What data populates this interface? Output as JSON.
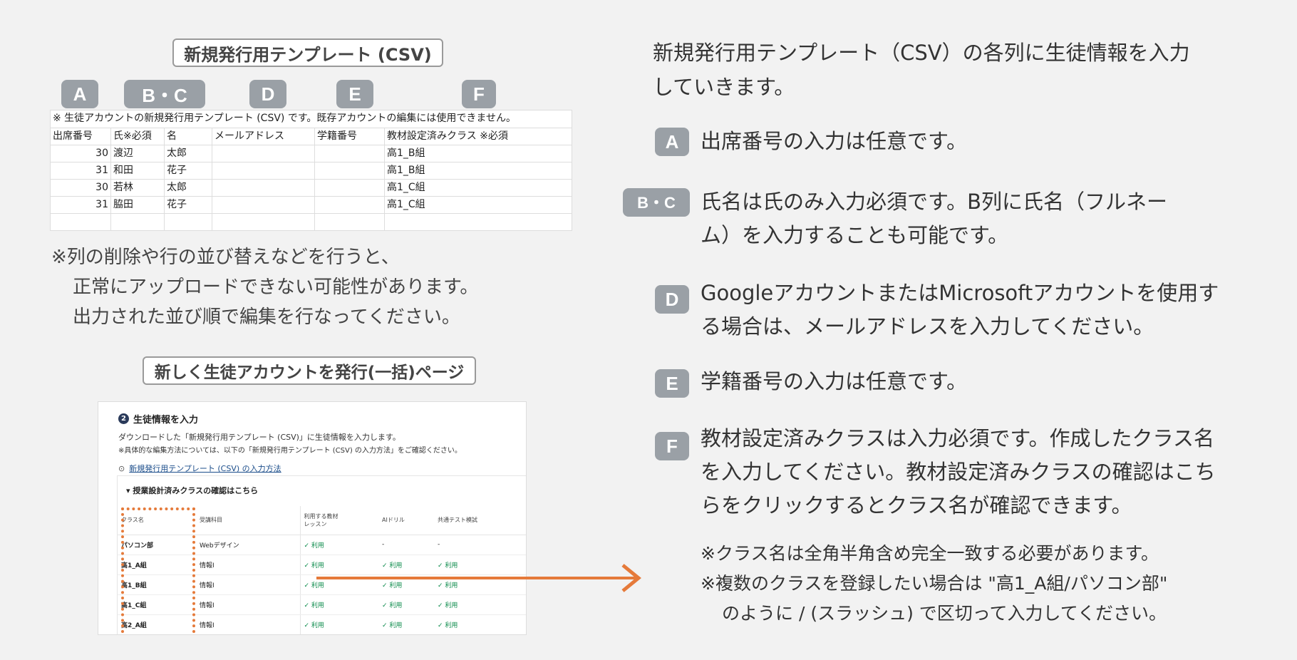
{
  "left": {
    "template_title": "新規発行用テンプレート (CSV)",
    "column_badges": [
      "A",
      "B・C",
      "D",
      "E",
      "F"
    ],
    "csv": {
      "note": "※ 生徒アカウントの新規発行用テンプレート (CSV) です。既存アカウントの編集には使用できません。",
      "headers": [
        "出席番号",
        "氏※必須",
        "名",
        "メールアドレス",
        "学籍番号",
        "教材設定済みクラス ※必須"
      ],
      "rows": [
        [
          "30",
          "渡辺",
          "太郎",
          "",
          "",
          "高1_B組"
        ],
        [
          "31",
          "和田",
          "花子",
          "",
          "",
          "高1_B組"
        ],
        [
          "30",
          "若林",
          "太郎",
          "",
          "",
          "高1_C組"
        ],
        [
          "31",
          "脇田",
          "花子",
          "",
          "",
          "高1_C組"
        ],
        [
          "",
          "",
          "",
          "",
          "",
          ""
        ]
      ]
    },
    "warning": {
      "line1": "※列の削除や行の並び替えなどを行うと、",
      "line2": "正常にアップロードできない可能性があります。",
      "line3": "出力された並び順で編集を行なってください。"
    },
    "page_title": "新しく生徒アカウントを発行(一括)ページ",
    "screenshot": {
      "step_number": "2",
      "step_title": "生徒情報を入力",
      "desc1": "ダウンロードした「新規発行用テンプレート (CSV)」に生徒情報を入力します。",
      "desc2": "※具体的な編集方法については、以下の「新規発行用テンプレート (CSV) の入力方法」をご確認ください。",
      "link_text": "新規発行用テンプレート (CSV) の入力方法",
      "panel_title": "授業設計済みクラスの確認はこちら",
      "table_headers": [
        "クラス名",
        "受講科目",
        "利用する教材",
        "レッスン",
        "AIドリル",
        "共通テスト模試"
      ],
      "rows": [
        [
          "パソコン部",
          "Webデザイン",
          "✓ 利用",
          "-",
          "-"
        ],
        [
          "高1_A組",
          "情報I",
          "✓ 利用",
          "✓ 利用",
          "✓ 利用"
        ],
        [
          "高1_B組",
          "情報I",
          "✓ 利用",
          "✓ 利用",
          "✓ 利用"
        ],
        [
          "高1_C組",
          "情報I",
          "✓ 利用",
          "✓ 利用",
          "✓ 利用"
        ],
        [
          "高2_A組",
          "情報I",
          "✓ 利用",
          "✓ 利用",
          "✓ 利用"
        ]
      ]
    }
  },
  "right": {
    "intro_line1": "新規発行用テンプレート（CSV）の各列に生徒情報を入力",
    "intro_line2": "していきます。",
    "items": [
      {
        "badge": "A",
        "lines": [
          "出席番号の入力は任意です。"
        ]
      },
      {
        "badge": "B・C",
        "lines": [
          "氏名は氏のみ入力必須です。B列に氏名（フルネー",
          "ム）を入力することも可能です。"
        ]
      },
      {
        "badge": "D",
        "lines": [
          "GoogleアカウントまたはMicrosoftアカウントを使用す",
          "る場合は、メールアドレスを入力してください。"
        ]
      },
      {
        "badge": "E",
        "lines": [
          "学籍番号の入力は任意です。"
        ]
      },
      {
        "badge": "F",
        "lines": [
          "教材設定済みクラスは入力必須です。作成したクラス名",
          "を入力してください。教材設定済みクラスの確認はこち",
          "らをクリックするとクラス名が確認できます。"
        ]
      }
    ],
    "notes": {
      "line1": "※クラス名は全角半角含め完全一致する必要があります。",
      "line2": "※複数のクラスを登録したい場合は \"高1_A組/パソコン部\"",
      "line3": "のように / (スラッシュ) で区切って入力してください。"
    }
  },
  "colors": {
    "badge": "#9aa0a6",
    "accent_orange": "#e57a3a",
    "background": "#f2f2f2"
  }
}
